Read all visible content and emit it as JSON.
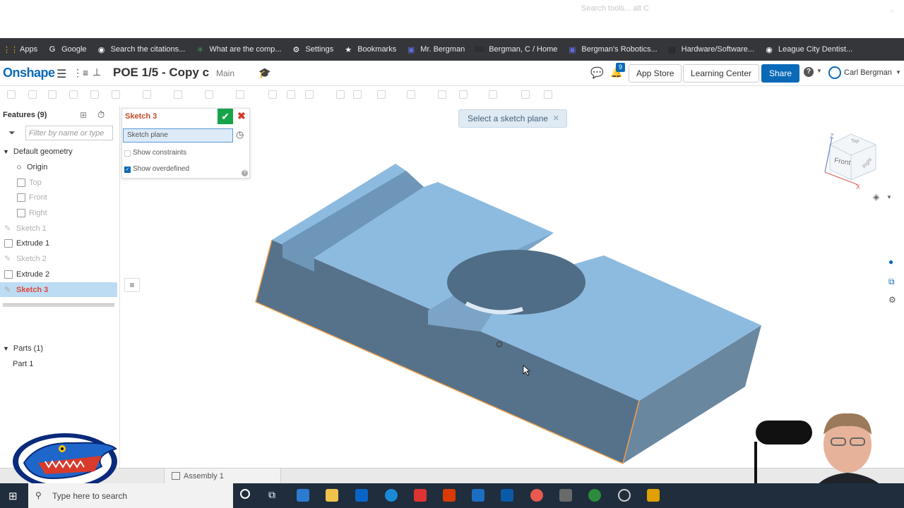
{
  "bookmarks": [
    {
      "label": "Apps",
      "icon": "apps-grid-icon",
      "color": "#f4b400"
    },
    {
      "label": "Google",
      "icon": "google-icon",
      "color": "#ffffff"
    },
    {
      "label": "Search the citations...",
      "icon": "globe-icon",
      "color": "#ffffff"
    },
    {
      "label": "What are the comp...",
      "icon": "asterisk-icon",
      "color": "#34a853"
    },
    {
      "label": "Settings",
      "icon": "gear-icon",
      "color": "#ffffff"
    },
    {
      "label": "Bookmarks",
      "icon": "star-icon",
      "color": "#ffffff"
    },
    {
      "label": "Mr. Bergman",
      "icon": "classroom-icon",
      "color": "#5f6edb"
    },
    {
      "label": "Bergman, C / Home",
      "icon": "bb-icon",
      "color": "#222222"
    },
    {
      "label": "Bergman's Robotics...",
      "icon": "classroom-icon",
      "color": "#5f6edb"
    },
    {
      "label": "Hardware/Software...",
      "icon": "page-icon",
      "color": "#222222"
    },
    {
      "label": "League City Dentist...",
      "icon": "globe-icon",
      "color": "#ffffff"
    }
  ],
  "bookmarks_more": "»",
  "header": {
    "logo": "Onshape",
    "doc_title": "POE 1/5 - Copy c",
    "branch": "Main",
    "app_store": "App Store",
    "learning_center": "Learning Center",
    "share": "Share",
    "help": "?",
    "user": "Carl Bergman",
    "notification_count": "9"
  },
  "toolbar": {
    "search_placeholder": "Search tools...   alt C"
  },
  "features": {
    "title": "Features (9)",
    "filter_placeholder": "Filter by name or type",
    "default_geometry": "Default geometry",
    "items": [
      {
        "label": "Origin",
        "state": "normal"
      },
      {
        "label": "Top",
        "state": "dim"
      },
      {
        "label": "Front",
        "state": "dim"
      },
      {
        "label": "Right",
        "state": "dim"
      },
      {
        "label": "Sketch 1",
        "state": "dim"
      },
      {
        "label": "Extrude 1",
        "state": "normal"
      },
      {
        "label": "Sketch 2",
        "state": "dim"
      },
      {
        "label": "Extrude 2",
        "state": "normal"
      },
      {
        "label": "Sketch 3",
        "state": "active"
      }
    ],
    "parts_title": "Parts (1)",
    "part1": "Part 1"
  },
  "sketch_dialog": {
    "title": "Sketch 3",
    "plane_field": "Sketch plane",
    "show_constraints": "Show constraints",
    "show_overdefined": "Show overdefined",
    "show_constraints_checked": false,
    "show_overdefined_checked": true
  },
  "toast": "Select a sketch plane",
  "view_cube": {
    "face": "Front",
    "top": "Top",
    "right": "Right",
    "axis_z": "Z",
    "axis_x": "X"
  },
  "bottom_tabs": {
    "assembly": "Assembly 1"
  },
  "taskbar": {
    "search_placeholder": "Type here to search"
  },
  "colors": {
    "brand_blue": "#0b6ab8",
    "model_top": "#8dbbe0",
    "model_side": "#56728a",
    "active_feature_bg": "#bcdcf3",
    "active_feature_text": "#e0483b",
    "confirm_green": "#16a34a"
  }
}
